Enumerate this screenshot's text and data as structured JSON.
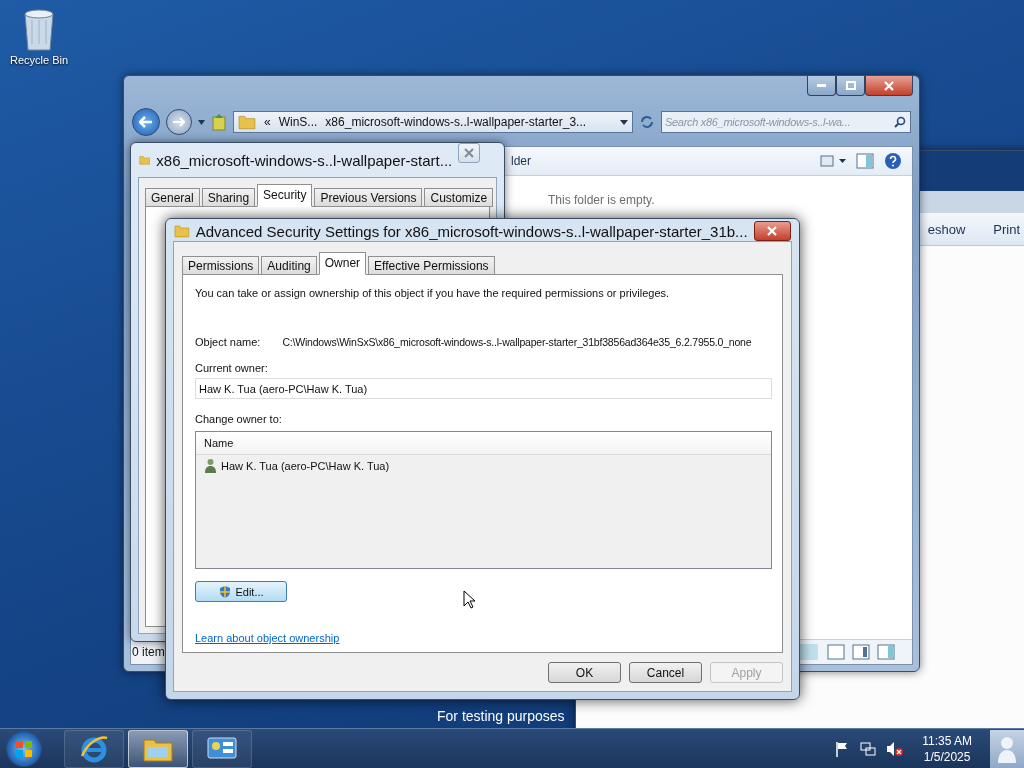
{
  "desktop": {
    "icons": [
      {
        "label": "Recycle Bin"
      }
    ],
    "build_notice": "For testing purposes"
  },
  "background_window": {
    "toolbar": [
      "eshow",
      "Print"
    ]
  },
  "explorer": {
    "address": [
      "«",
      "WinS...",
      "x86_microsoft-windows-s..l-wallpaper-starter_3..."
    ],
    "search": {
      "placeholder": "Search x86_microsoft-windows-s..l-wa..."
    },
    "toolbar_text": "lder",
    "empty_text": "This folder is empty.",
    "status": "0 item"
  },
  "properties": {
    "title": "x86_microsoft-windows-s..l-wallpaper-start...",
    "tabs": [
      {
        "label": "General",
        "selected": false
      },
      {
        "label": "Sharing",
        "selected": false
      },
      {
        "label": "Security",
        "selected": true
      },
      {
        "label": "Previous Versions",
        "selected": false
      },
      {
        "label": "Customize",
        "selected": false
      }
    ]
  },
  "advanced": {
    "title": "Advanced Security Settings for x86_microsoft-windows-s..l-wallpaper-starter_31b...",
    "tabs": [
      {
        "label": "Permissions",
        "selected": false
      },
      {
        "label": "Auditing",
        "selected": false
      },
      {
        "label": "Owner",
        "selected": true
      },
      {
        "label": "Effective Permissions",
        "selected": false
      }
    ],
    "intro": "You can take or assign ownership of this object if you have the required permissions or privileges.",
    "object_name_label": "Object name:",
    "object_name": "C:\\Windows\\WinSxS\\x86_microsoft-windows-s..l-wallpaper-starter_31bf3856ad364e35_6.2.7955.0_none",
    "current_owner_label": "Current owner:",
    "current_owner": "Haw K. Tua (aero-PC\\Haw K. Tua)",
    "change_owner_label": "Change owner to:",
    "list_header": "Name",
    "list_rows": [
      {
        "name": "Haw K. Tua (aero-PC\\Haw K. Tua)",
        "selected": false
      }
    ],
    "edit_button": "Edit...",
    "link": "Learn about object ownership",
    "buttons": [
      {
        "label": "OK",
        "disabled": false
      },
      {
        "label": "Cancel",
        "disabled": false
      },
      {
        "label": "Apply",
        "disabled": true
      }
    ]
  },
  "taskbar": {
    "apps": [
      {
        "kind": "ie",
        "active": false
      },
      {
        "kind": "explorer",
        "active": true
      },
      {
        "kind": "control",
        "active": false
      }
    ],
    "tray": {
      "muted": true
    },
    "time": "11:35 AM",
    "date": "1/5/2025"
  }
}
